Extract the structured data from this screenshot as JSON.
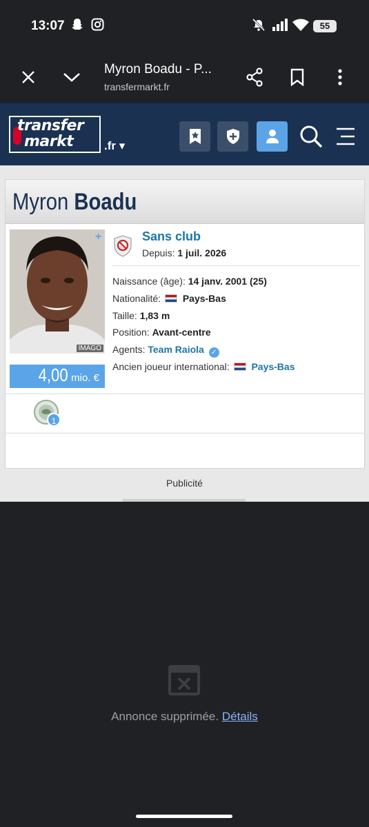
{
  "status_bar": {
    "time": "13:07",
    "battery": "55",
    "icons": [
      "snapchat-icon",
      "instagram-icon",
      "mute-icon",
      "signal-icon",
      "wifi-icon",
      "battery-icon"
    ]
  },
  "browser": {
    "title": "Myron Boadu - P...",
    "url": "transfermarkt.fr",
    "icons": [
      "close-icon",
      "chevron-down-icon",
      "share-icon",
      "bookmark-icon",
      "more-icon"
    ]
  },
  "site_header": {
    "logo_line1": "transfer",
    "logo_line2": "markt",
    "domain": ".fr ▾",
    "buttons": [
      "watchlist-icon",
      "club-shield-icon",
      "user-icon",
      "search-icon",
      "menu-icon"
    ],
    "colors": {
      "header_bg": "#1a3151",
      "accent": "#5ba4e8"
    }
  },
  "player": {
    "first_name": "Myron",
    "last_name": "Boadu",
    "photo_credit": "IMAGO",
    "market_value": "4,00",
    "market_value_unit": "mio. €",
    "club": "Sans club",
    "since_label": "Depuis:",
    "since_value": "1 juil. 2026",
    "birth_label": "Naissance (âge):",
    "birth_value": "14 janv. 2001 (25)",
    "nationality_label": "Nationalité:",
    "nationality_value": "Pays-Bas",
    "height_label": "Taille:",
    "height_value": "1,83 m",
    "position_label": "Position:",
    "position_value": "Avant-centre",
    "agent_label": "Agents:",
    "agent_value": "Team Raiola",
    "former_international_label": "Ancien joueur international:",
    "former_international_value": "Pays-Bas",
    "trophy_count": "1"
  },
  "ad": {
    "publicite_label": "Publicité",
    "removed_text": "Annonce supprimée.",
    "details_link": "Détails"
  }
}
